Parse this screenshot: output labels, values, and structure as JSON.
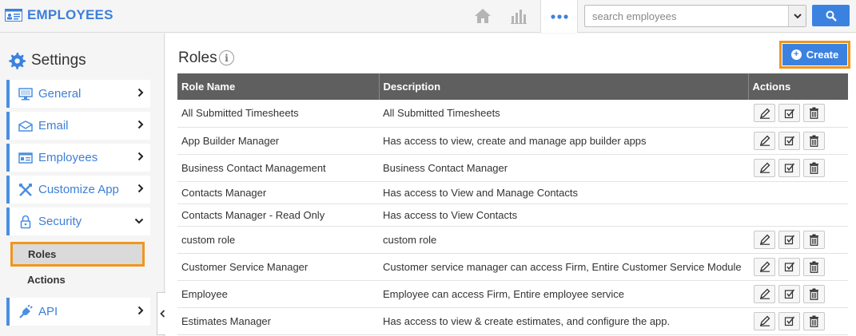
{
  "app": {
    "title": "EMPLOYEES"
  },
  "search": {
    "placeholder": "search employees"
  },
  "sidebar": {
    "title": "Settings",
    "items": [
      {
        "label": "General",
        "icon": "monitor-icon"
      },
      {
        "label": "Email",
        "icon": "envelope-icon"
      },
      {
        "label": "Employees",
        "icon": "id-card-icon"
      },
      {
        "label": "Customize App",
        "icon": "tools-icon"
      },
      {
        "label": "Security",
        "icon": "lock-icon"
      }
    ],
    "security_sub": [
      {
        "label": "Roles",
        "active": true
      },
      {
        "label": "Actions",
        "active": false
      }
    ],
    "api": {
      "label": "API",
      "icon": "plug-icon"
    }
  },
  "main": {
    "title": "Roles",
    "create_label": "Create",
    "columns": [
      "Role Name",
      "Description",
      "Actions"
    ],
    "rows": [
      {
        "name": "All Submitted Timesheets",
        "description": "All Submitted Timesheets",
        "actions": true
      },
      {
        "name": "App Builder Manager",
        "description": "Has access to view, create and manage app builder apps",
        "actions": true
      },
      {
        "name": "Business Contact Management",
        "description": "Business Contact Manager",
        "actions": true
      },
      {
        "name": "Contacts Manager",
        "description": "Has access to View and Manage Contacts",
        "actions": false
      },
      {
        "name": "Contacts Manager - Read Only",
        "description": "Has access to View Contacts",
        "actions": false
      },
      {
        "name": "custom role",
        "description": "custom role",
        "actions": true
      },
      {
        "name": "Customer Service Manager",
        "description": "Customer service manager can access Firm, Entire Customer Service Module",
        "actions": true
      },
      {
        "name": "Employee",
        "description": "Employee can access Firm, Entire employee service",
        "actions": true
      },
      {
        "name": "Estimates Manager",
        "description": "Has access to view & create estimates, and configure the app.",
        "actions": true
      }
    ]
  },
  "colors": {
    "accent": "#3b82e0",
    "highlight": "#f0961e",
    "header_bg": "#5f5f5f"
  }
}
